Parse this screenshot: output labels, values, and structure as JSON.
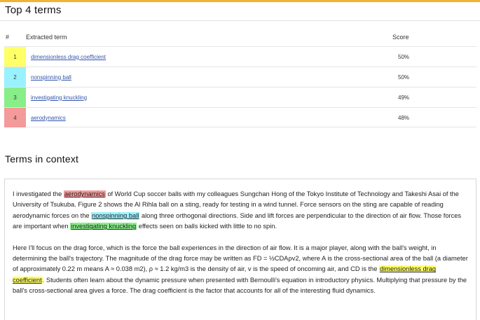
{
  "top_terms": {
    "title": "Top 4 terms",
    "columns": {
      "num": "#",
      "term": "Extracted term",
      "score": "Score"
    },
    "rows": [
      {
        "rank": "1",
        "term": "dimensionless drag coefficient",
        "score": "50%",
        "color": "#ffff66"
      },
      {
        "rank": "2",
        "term": "nonspinning ball",
        "score": "50%",
        "color": "#99f2ff"
      },
      {
        "rank": "3",
        "term": "investigating knuckling",
        "score": "49%",
        "color": "#88ee88"
      },
      {
        "rank": "4",
        "term": "aerodynamics",
        "score": "48%",
        "color": "#f49a9a"
      }
    ]
  },
  "context": {
    "title": "Terms in context",
    "p1": {
      "t1": "I investigated the ",
      "hl_aero": "aerodynamics",
      "t2": " of World Cup soccer balls with my colleagues Sungchan Hong of the Tokyo Institute of Technology and Takeshi Asai of the University of Tsukuba. Figure 2 shows the Al Rihla ball on a sting, ready for testing in a wind tunnel. Force sensors on the sting are capable of reading aerodynamic forces on the ",
      "hl_nonspin": "nonspinning ball",
      "t3": " along three orthogonal directions. Side and lift forces are perpendicular to the direction of air flow. Those forces are important when ",
      "hl_knuck": "investigating knuckling",
      "t4": " effects seen on balls kicked with little to no spin."
    },
    "p2": {
      "t1": "Here I'll focus on the drag force, which is the force the ball experiences in the direction of air flow. It is a major player, along with the ball's weight, in determining the ball's trajectory. The magnitude of the drag force may be written as FD = ½CDAρv2, where A is the cross-sectional area of the ball (a diameter of approximately 0.22 m means A ≈ 0.038 m2), ρ ≈ 1.2 kg/m3 is the density of air, v is the speed of oncoming air, and CD is the ",
      "hl_drag": "dimensionless drag coefficient",
      "t2": ". Students often learn about the dynamic pressure when presented with Bernoulli's equation in introductory physics. Multiplying that pressure by the ball's cross-sectional area gives a force. The drag coefficient is the factor that accounts for all of the interesting fluid dynamics."
    }
  }
}
